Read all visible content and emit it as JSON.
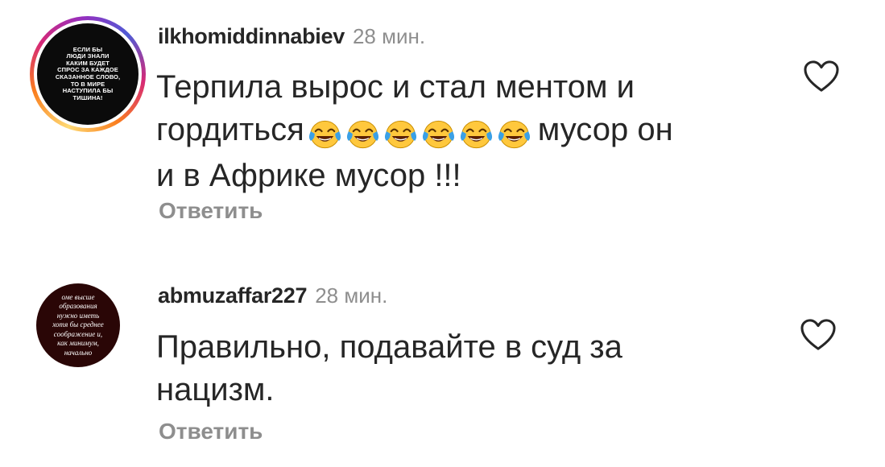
{
  "comments": [
    {
      "username": "ilkhomiddinnabiev",
      "timestamp": "28 мин.",
      "avatar_text": "ЕСЛИ БЫ\nЛЮДИ ЗНАЛИ\nКАКИМ БУДЕТ\nСПРОС ЗА КАЖДОЕ\nСКАЗАННОЕ СЛОВО,\nТО В МИРЕ\nНАСТУПИЛА БЫ\nТИШИНА!",
      "text_line_1": "Терпила вырос и стал ментом и",
      "text_line_2_start": "гордиться",
      "emoji_icon": "face-with-tears-of-joy",
      "emoji_count": 6,
      "text_line_2_end": "мусор он",
      "text_line_3": "и в Африке мусор !!!",
      "reply_label": "Ответить",
      "like_icon": "heart-outline-icon"
    },
    {
      "username": "abmuzaffar227",
      "timestamp": "28 мин.",
      "avatar_text": "оме высше\nобразования\nнужно иметь\nхотя бы среднее\nсоображение и,\nкак минимум,\nначально",
      "text_line_1": "Правильно, подавайте в суд за",
      "text_line_2": "нацизм.",
      "reply_label": "Ответить",
      "like_icon": "heart-outline-icon"
    }
  ],
  "colors": {
    "text": "#262626",
    "secondary": "#8e8e8e",
    "ring": "#d62976",
    "emoji_face": "#ffc83d",
    "emoji_tear": "#3aa0e6"
  }
}
